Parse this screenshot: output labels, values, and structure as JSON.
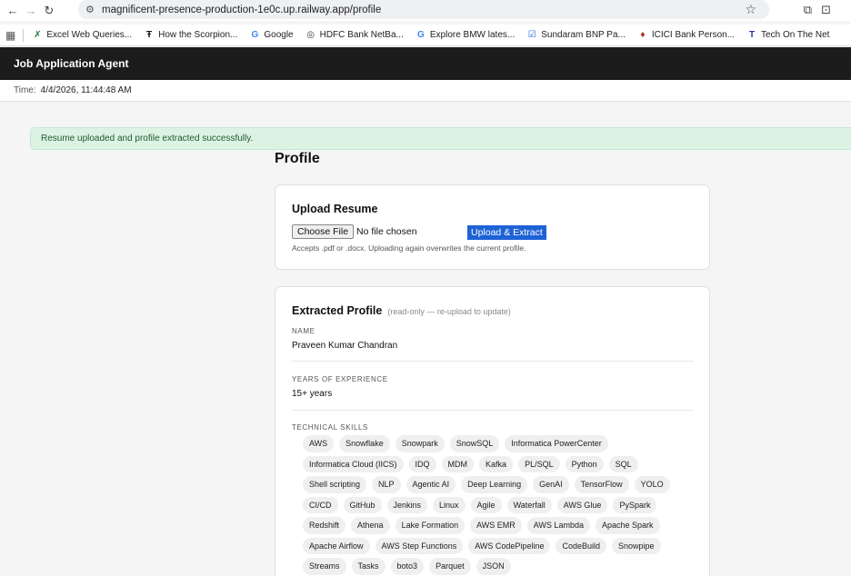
{
  "browser": {
    "url": "magnificent-presence-production-1e0c.up.railway.app/profile",
    "bookmarks": [
      {
        "label": "Excel Web Queries...",
        "icon": "excel-icon"
      },
      {
        "label": "How the Scorpion...",
        "icon": "nyt-icon"
      },
      {
        "label": "Google",
        "icon": "google-icon"
      },
      {
        "label": "HDFC Bank NetBa...",
        "icon": "globe-icon"
      },
      {
        "label": "Explore BMW lates...",
        "icon": "google-icon"
      },
      {
        "label": "Sundaram BNP Pa...",
        "icon": "checkbox-icon"
      },
      {
        "label": "ICICI Bank Person...",
        "icon": "icici-icon"
      },
      {
        "label": "Tech On The Net",
        "icon": "t-icon"
      }
    ]
  },
  "app": {
    "title": "Job Application Agent",
    "time_label": "Time:",
    "time_value": "4/4/2026, 11:44:48 AM"
  },
  "alert": {
    "message": "Resume uploaded and profile extracted successfully."
  },
  "page": {
    "title": "Profile"
  },
  "upload": {
    "heading": "Upload Resume",
    "choose_label": "Choose File",
    "file_status": "No file chosen",
    "submit_label": "Upload & Extract",
    "hint": "Accepts .pdf or .docx. Uploading again overwrites the current profile."
  },
  "profile": {
    "heading": "Extracted Profile",
    "subheading": "(read-only — re-upload to update)",
    "name_label": "NAME",
    "name_value": "Praveen Kumar Chandran",
    "exp_label": "YEARS OF EXPERIENCE",
    "exp_value": "15+ years",
    "skills_label": "TECHNICAL SKILLS",
    "skills": [
      "AWS",
      "Snowflake",
      "Snowpark",
      "SnowSQL",
      "Informatica PowerCenter",
      "Informatica Cloud (IICS)",
      "IDQ",
      "MDM",
      "Kafka",
      "PL/SQL",
      "Python",
      "SQL",
      "Shell scripting",
      "NLP",
      "Agentic AI",
      "Deep Learning",
      "GenAI",
      "TensorFlow",
      "YOLO",
      "CI/CD",
      "GitHub",
      "Jenkins",
      "Linux",
      "Agile",
      "Waterfall",
      "AWS Glue",
      "PySpark",
      "Redshift",
      "Athena",
      "Lake Formation",
      "AWS EMR",
      "AWS Lambda",
      "Apache Spark",
      "Apache Airflow",
      "AWS Step Functions",
      "AWS CodePipeline",
      "CodeBuild",
      "Snowpipe",
      "Streams",
      "Tasks",
      "boto3",
      "Parquet",
      "JSON"
    ]
  }
}
